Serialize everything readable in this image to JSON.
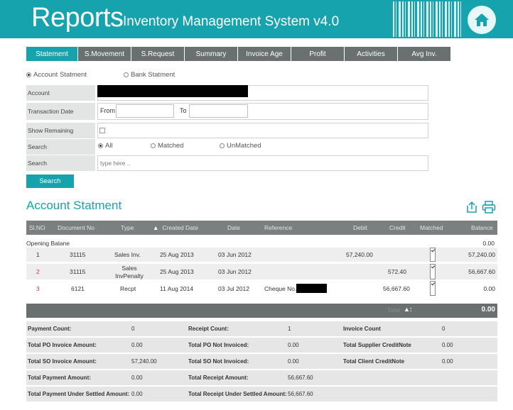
{
  "header": {
    "title_main": "Reports",
    "title_sub": "Inventory Management System v4.0",
    "accent": "#16a3ad"
  },
  "tabs": [
    "Statement",
    "S.Movement",
    "S.Request",
    "Summary",
    "Invoice Age",
    "Profit",
    "Activities",
    "Avg Inv."
  ],
  "statement_type": {
    "account_label": "Account Statment",
    "bank_label": "Bank Statment",
    "selected": "Account Statment"
  },
  "form": {
    "account_label": "Account",
    "transaction_date_label": "Transaction Date",
    "from_label": "From",
    "to_label": "To",
    "show_remaining_label": "Show Remaining",
    "search_label": "Search",
    "filter_all": "All",
    "filter_matched": "Matched",
    "filter_unmatched": "UnMatched",
    "search_text_label": "Search",
    "search_placeholder": "type here ..",
    "search_button": "Search"
  },
  "section_title": "Account Statment",
  "table": {
    "columns": {
      "slno": "Sl.NO",
      "document_no": "Document No",
      "type": "Type",
      "created_date": "Created Date",
      "date": "Date",
      "reference": "Reference",
      "debit": "Debit",
      "credit": "Credit",
      "matched": "Matched",
      "balance": "Balance"
    },
    "opening_label": "Opening Balane",
    "opening_value": "0.00",
    "rows": [
      {
        "slno": "1",
        "doc": "31115",
        "type": "Sales Inv.",
        "created": "25 Aug 2013",
        "date": "03 Jun 2012",
        "ref": "",
        "debit": "57,240.00",
        "credit": "",
        "balance": "57,240.00"
      },
      {
        "slno": "2",
        "doc": "31115",
        "type_line1": "Sales",
        "type_line2": "InvPenalty",
        "created": "25 Aug 2013",
        "date": "03 Jun 2012",
        "ref": "",
        "debit": "",
        "credit": "572.40",
        "balance": "56,667.60"
      },
      {
        "slno": "3",
        "doc": "6121",
        "type": "Recpt",
        "created": "11 Aug 2014",
        "date": "03 Jul 2012",
        "ref": "Cheque No.",
        "debit": "",
        "credit": "56,667.60",
        "balance": "0.00"
      }
    ],
    "total_label": "Total",
    "total_value": "0.00"
  },
  "summary": {
    "payment_count_label": "Payment Count:",
    "payment_count": "0",
    "receipt_count_label": "Receipt Count:",
    "receipt_count": "1",
    "invoice_count_label": "Invoice Count",
    "invoice_count": "0",
    "po_invoice_label": "Total PO Invoice Amount:",
    "po_invoice": "0.00",
    "po_not_invoiced_label": "Total PO Not Invoiced:",
    "po_not_invoiced": "0.00",
    "supplier_cn_label": "Total Supplier CreditNote",
    "supplier_cn": "0.00",
    "so_invoice_label": "Total SO Invoice Amount:",
    "so_invoice": "57,240.00",
    "so_not_invoiced_label": "Total SO Not Invoiced:",
    "so_not_invoiced": "0.00",
    "client_cn_label": "Total Client CreditNote",
    "client_cn": "0.00",
    "payment_amount_label": "Total Payment Amount:",
    "payment_amount": "0.00",
    "receipt_amount_label": "Total Receipt Amount:",
    "receipt_amount": "56,667.60",
    "payment_unsettled_label": "Total Payment Under Settled Amount:",
    "payment_unsettled": "0.00",
    "receipt_unsettled_label": "Total Receipt Under Settled Amount:",
    "receipt_unsettled": "56,667.60"
  }
}
